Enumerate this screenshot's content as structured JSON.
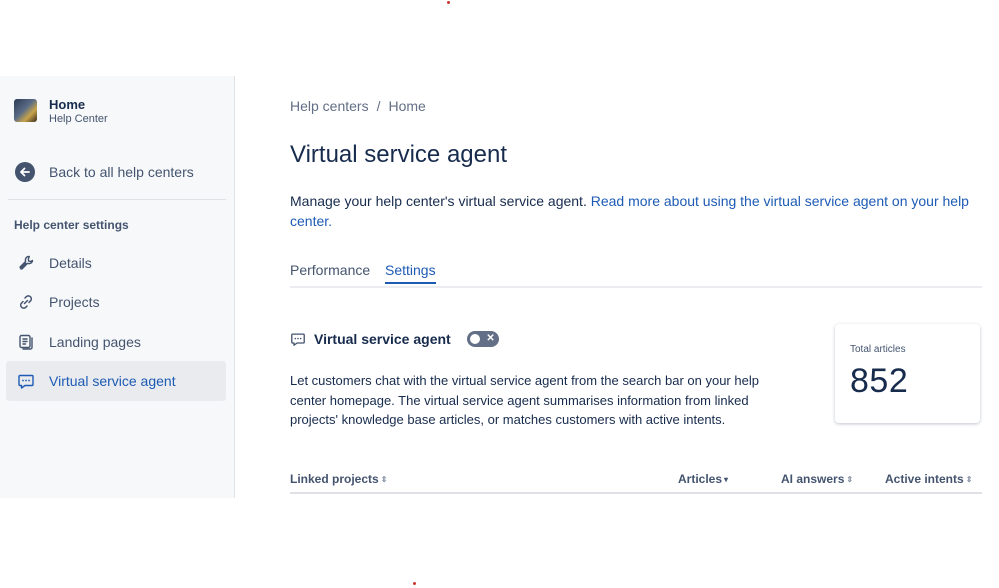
{
  "sidebar": {
    "help_center": {
      "title": "Home",
      "subtitle": "Help Center"
    },
    "back_label": "Back to all help centers",
    "section_title": "Help center settings",
    "items": [
      {
        "label": "Details",
        "icon": "wrench-icon"
      },
      {
        "label": "Projects",
        "icon": "link-icon"
      },
      {
        "label": "Landing pages",
        "icon": "pages-icon"
      },
      {
        "label": "Virtual service agent",
        "icon": "chat-icon",
        "active": true
      }
    ]
  },
  "breadcrumb": {
    "parent": "Help centers",
    "separator": "/",
    "current": "Home"
  },
  "page": {
    "title": "Virtual service agent",
    "description_text": "Manage your help center's virtual service agent. ",
    "description_link": "Read more about using the virtual service agent on your help center."
  },
  "tabs": [
    {
      "label": "Performance",
      "selected": false
    },
    {
      "label": "Settings",
      "selected": true
    }
  ],
  "vsa": {
    "label": "Virtual service agent",
    "toggle_on": false,
    "description": "Let customers chat with the virtual service agent from the search bar on your help center homepage. The virtual service agent summarises information from linked projects' knowledge base articles, or matches customers with active intents."
  },
  "stat": {
    "label": "Total articles",
    "value": "852"
  },
  "table": {
    "columns": [
      "Linked projects",
      "Articles",
      "AI answers",
      "Active intents"
    ]
  },
  "colors": {
    "accent": "#1d5bb5",
    "text": "#172b4d",
    "subtle": "#44546f"
  }
}
